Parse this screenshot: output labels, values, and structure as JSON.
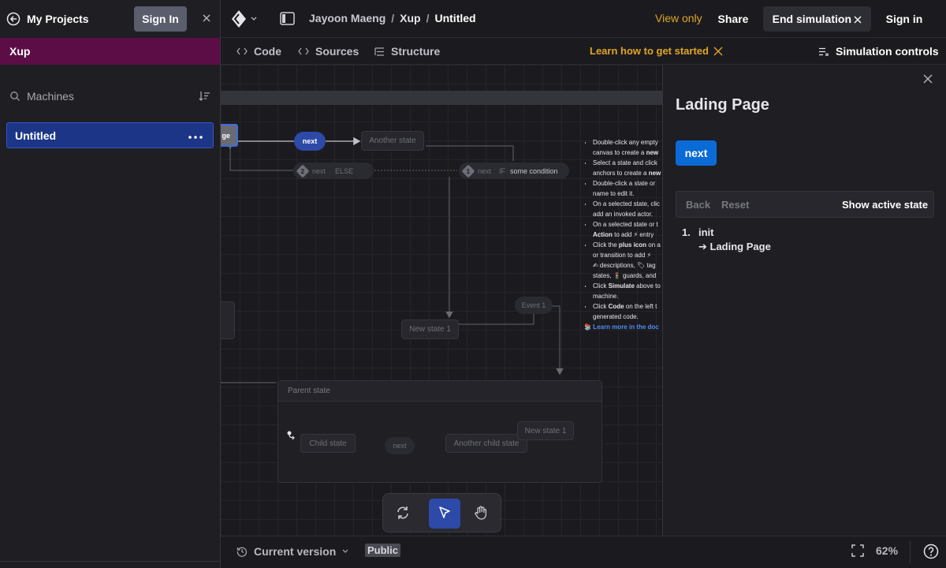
{
  "sidebar": {
    "my_projects": "My Projects",
    "sign_in": "Sign In",
    "project_name": "Xup",
    "search_label": "Machines",
    "machines": [
      {
        "label": "Untitled"
      }
    ]
  },
  "topbar": {
    "breadcrumb": {
      "owner": "Jayoon Maeng",
      "project": "Xup",
      "machine": "Untitled",
      "separator": "/"
    },
    "view_only": "View only",
    "share": "Share",
    "end_simulation": "End simulation",
    "sign_in": "Sign in"
  },
  "tabs": {
    "items": [
      {
        "label": "Code"
      },
      {
        "label": "Sources"
      },
      {
        "label": "Structure"
      }
    ],
    "learn": "Learn how to get started",
    "simulation_controls": "Simulation controls"
  },
  "canvas": {
    "active_state_fragment": "ge",
    "event_next": "next",
    "another_state": "Another state",
    "guard_2": {
      "num": "2",
      "event": "next",
      "keyword": "ELSE"
    },
    "guard_1": {
      "num": "1",
      "event": "next",
      "keyword": "IF",
      "condition": "some condition"
    },
    "event_1": "Event 1",
    "new_state_1": "New state 1",
    "parent_state": "Parent state",
    "child_state": "Child state",
    "child_event": "next",
    "another_child_state": "Another child state",
    "new_state_1b": "New state 1",
    "help": [
      {
        "a": "Double-click any empty",
        "b": "canvas to create a ",
        "bold": "new"
      },
      {
        "a": "Select a state and click",
        "b": "anchors to create a ",
        "bold": "new"
      },
      {
        "a": "Double-click a state or",
        "b": "name to edit it."
      },
      {
        "a": "On a selected state, clic",
        "b": "add an invoked actor."
      },
      {
        "a": "On a selected state or t",
        "bold_b": "Action",
        "b": " to add ⚡ entry"
      },
      {
        "a": "Click the ",
        "bold_a": "plus icon",
        "a2": " on a",
        "b": "or transition to add ⚡",
        "c": "✍ descriptions, 🏷 tag",
        "d": "states, 🚦 guards, and"
      },
      {
        "a": "Click ",
        "bold_a": "Simulate",
        "a2": " above to",
        "b": "machine."
      },
      {
        "a": "Click ",
        "bold_a": "Code",
        "a2": " on the left t",
        "b": "generated code."
      }
    ],
    "learn_more": "📚 Learn more in the doc"
  },
  "panel": {
    "title": "Lading Page",
    "event_button": "next",
    "back": "Back",
    "reset": "Reset",
    "show_active_state": "Show active state",
    "history": [
      {
        "num": "1.",
        "event": "init",
        "target": "➔ Lading Page"
      }
    ]
  },
  "bottombar": {
    "version": "Current version",
    "visibility": "Public",
    "zoom": "62%"
  },
  "colors": {
    "accent_blue": "#0b6bd6",
    "active_state": "#2d4aa8",
    "project_bar": "#5c0d46",
    "warning": "#e0a526"
  }
}
